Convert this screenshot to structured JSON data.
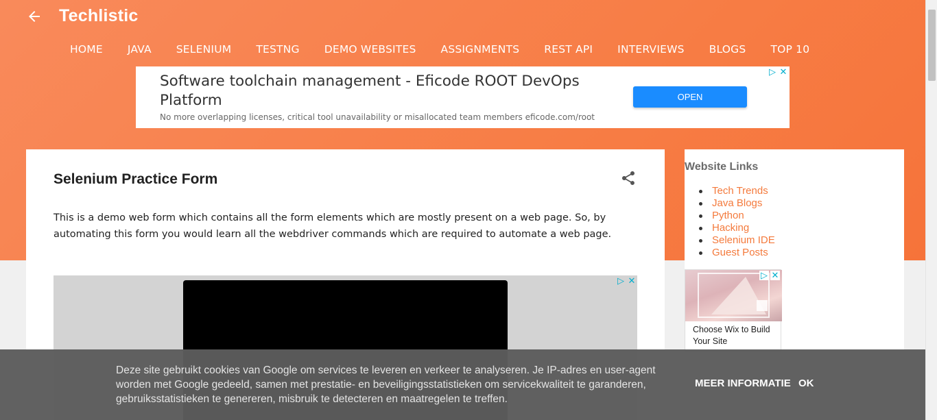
{
  "header": {
    "site_title": "Techlistic",
    "back_icon": "arrow-left-icon"
  },
  "nav": {
    "items": [
      "HOME",
      "JAVA",
      "SELENIUM",
      "TESTNG",
      "DEMO WEBSITES",
      "ASSIGNMENTS",
      "REST API",
      "INTERVIEWS",
      "BLOGS",
      "TOP 10"
    ]
  },
  "top_ad": {
    "title": "Software toolchain management - Eficode ROOT DevOps Platform",
    "subtitle": "No more overlapping licenses, critical tool unavailability or misallocated team members eficode.com/root",
    "button": "OPEN"
  },
  "post": {
    "title": "Selenium Practice Form",
    "body": "This is a demo web form which contains all the form elements which are mostly present on a web page. So, by automating this form you would learn all the webdriver commands which are required to automate a web page.",
    "share_icon": "share-icon"
  },
  "sidebar": {
    "heading": "Website Links",
    "links": [
      "Tech Trends",
      "Java Blogs",
      "Python",
      "Hacking",
      "Selenium IDE",
      "Guest Posts"
    ],
    "ad_caption": "Choose Wix to Build Your Site"
  },
  "cookie": {
    "text": "Deze site gebruikt cookies van Google om services te leveren en verkeer te analyseren. Je IP-adres en user-agent worden met Google gedeeld, samen met prestatie- en beveiligingsstatistieken om servicekwaliteit te garanderen, gebruiksstatistieken te genereren, misbruik te detecteren en maatregelen te treffen.",
    "more_label": "MEER INFORMATIE",
    "ok_label": "OK"
  },
  "colors": {
    "header_orange": "#f77d45",
    "link_orange": "#f47a3c",
    "ad_button_blue": "#1a8cff",
    "cookie_bar": "#5c5c5c"
  }
}
